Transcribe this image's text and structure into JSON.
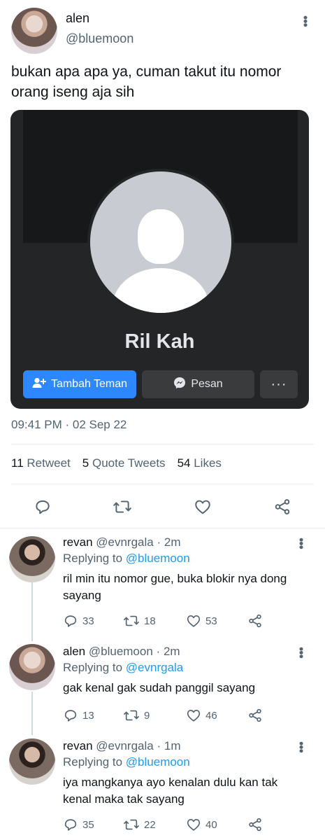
{
  "tweet": {
    "author_name": "alen",
    "author_handle": "@bluemoon",
    "text": "bukan apa apa ya, cuman takut itu nomor orang iseng aja sih",
    "timestamp": "09:41 PM · 02 Sep 22",
    "media": {
      "profile_name": "Ril Kah",
      "add_friend_label": "Tambah Teman",
      "message_label": "Pesan",
      "more_label": "···",
      "brand_color": "#2d88ff"
    },
    "stats": {
      "retweets_count": "11",
      "retweets_label": "Retweet",
      "quotes_count": "5",
      "quotes_label": "Quote Tweets",
      "likes_count": "54",
      "likes_label": "Likes"
    },
    "actions": [
      "reply-icon",
      "retweet-icon",
      "like-icon",
      "share-icon"
    ]
  },
  "replies": [
    {
      "name": "revan",
      "handle": "@evnrgala",
      "time": "2m",
      "replying_prefix": "Replying to",
      "replying_to": "@bluemoon",
      "text": "ril min itu nomor gue, buka blokir nya dong sayang",
      "replies": "33",
      "retweets": "18",
      "likes": "53"
    },
    {
      "name": "alen",
      "handle": "@bluemoon",
      "time": "2m",
      "replying_prefix": "Replying to",
      "replying_to": "@evnrgala",
      "text": "gak kenal gak sudah panggil sayang",
      "replies": "13",
      "retweets": "9",
      "likes": "46"
    },
    {
      "name": "revan",
      "handle": "@evnrgala",
      "time": "1m",
      "replying_prefix": "Replying to",
      "replying_to": "@bluemoon",
      "text": "iya mangkanya ayo kenalan dulu kan tak kenal maka tak sayang",
      "replies": "35",
      "retweets": "22",
      "likes": "40"
    }
  ],
  "colors": {
    "text_primary": "#0f1419",
    "text_secondary": "#536471",
    "mention": "#1d9bf0",
    "divider": "#e6ecf0"
  }
}
